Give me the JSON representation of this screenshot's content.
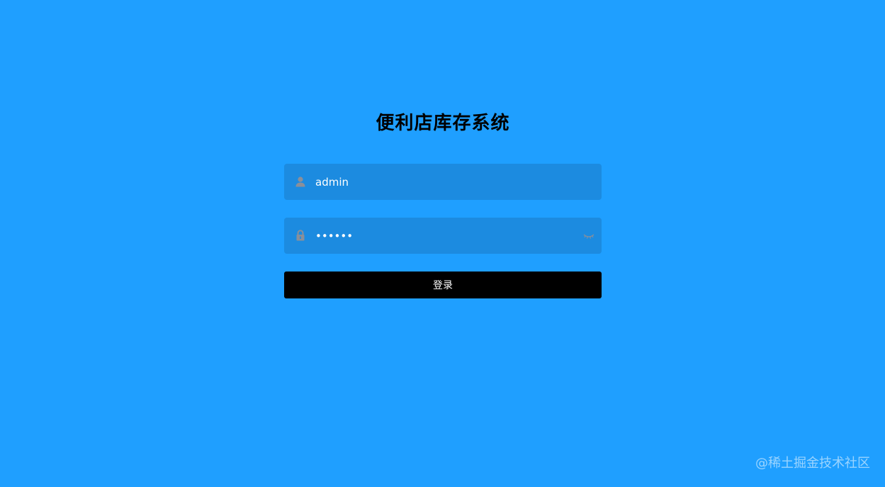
{
  "login": {
    "title": "便利店库存系统",
    "username": {
      "value": "admin",
      "icon": "user-icon"
    },
    "password": {
      "value": "123456",
      "icon": "lock-icon",
      "toggle_icon": "eye-closed-icon"
    },
    "submit_label": "登录"
  },
  "watermark": "@稀土掘金技术社区",
  "colors": {
    "background": "#1f9fff",
    "field_background": "#1c8be0",
    "button_background": "#000000",
    "icon_color": "#8a8f99"
  }
}
